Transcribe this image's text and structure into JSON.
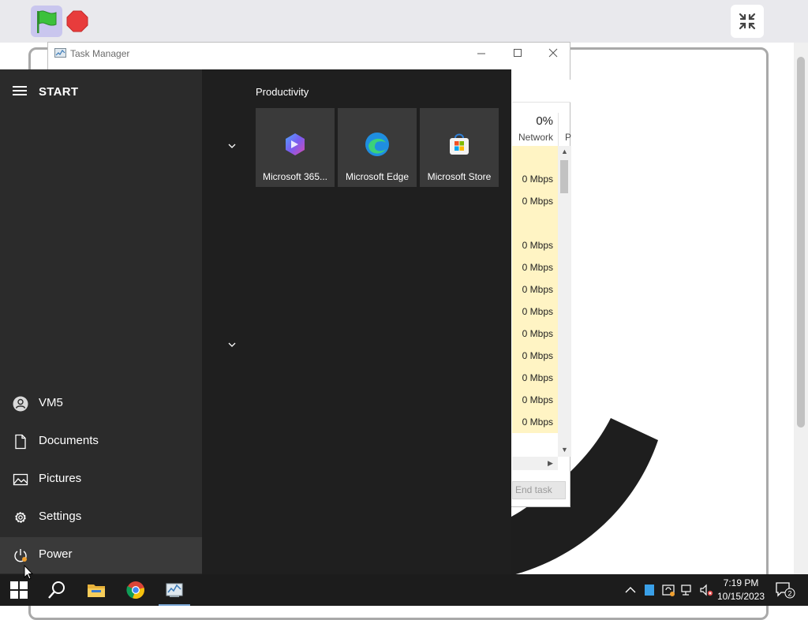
{
  "task_manager": {
    "title": "Task Manager",
    "network_percent": "0%",
    "network_label": "Network",
    "next_col_label": "P",
    "rows": [
      "",
      "0 Mbps",
      "0 Mbps",
      "",
      "0 Mbps",
      "0 Mbps",
      "0 Mbps",
      "0 Mbps",
      "0 Mbps",
      "0 Mbps",
      "0 Mbps",
      "0 Mbps",
      "0 Mbps"
    ],
    "end_task": "End task"
  },
  "start_menu": {
    "header": "START",
    "group_title": "Productivity",
    "tiles": [
      {
        "label": "Microsoft 365...",
        "icon": "microsoft-365-icon"
      },
      {
        "label": "Microsoft Edge",
        "icon": "edge-icon"
      },
      {
        "label": "Microsoft Store",
        "icon": "store-icon"
      }
    ],
    "side_items": [
      {
        "label": "VM5",
        "icon": "user-icon"
      },
      {
        "label": "Documents",
        "icon": "document-icon"
      },
      {
        "label": "Pictures",
        "icon": "pictures-icon"
      },
      {
        "label": "Settings",
        "icon": "gear-icon"
      },
      {
        "label": "Power",
        "icon": "power-icon"
      }
    ]
  },
  "taskbar": {
    "time": "7:19 PM",
    "date": "10/15/2023",
    "notification_count": "2"
  },
  "colors": {
    "start_left": "#2b2b2b",
    "start_right": "#1f1f1f",
    "taskbar": "#1c1c1c",
    "row_highlight": "#fff4c4",
    "flag_green": "#3cc13c",
    "stop_red": "#e83c3c"
  }
}
